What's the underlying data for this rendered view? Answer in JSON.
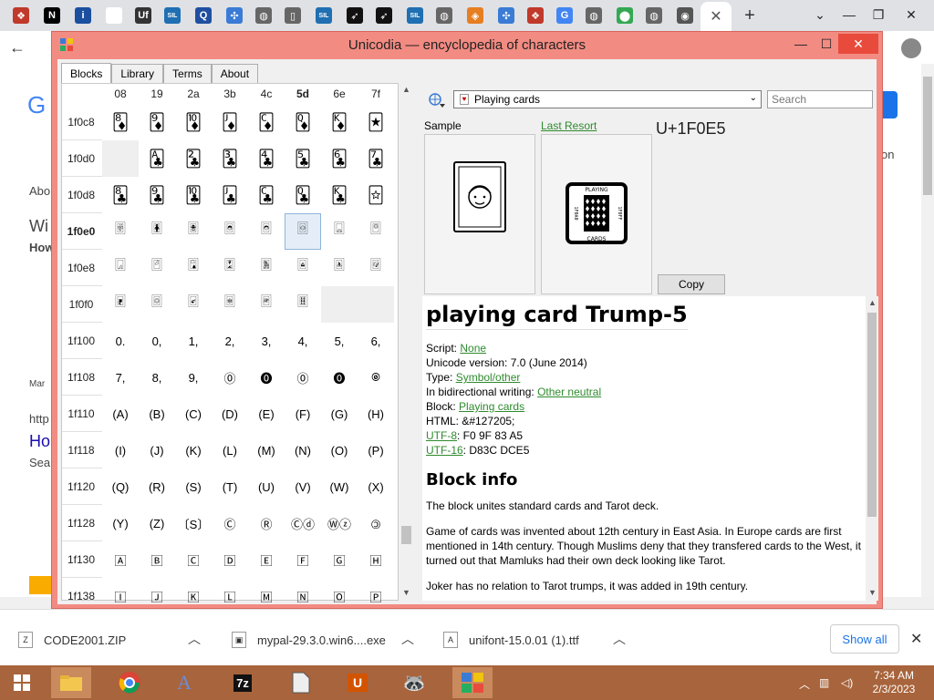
{
  "browser": {
    "tabs": [
      {
        "icon": "unicodia-icon",
        "glyph": "❖",
        "color": "#c0392b"
      },
      {
        "icon": "notion-icon",
        "glyph": "N",
        "color": "#000000"
      },
      {
        "icon": "info-icon",
        "glyph": "i",
        "color": "#1a4fa0"
      },
      {
        "icon": "blank-icon",
        "glyph": "",
        "color": "#ffffff"
      },
      {
        "icon": "uf-icon",
        "glyph": "Uf",
        "color": "#333333"
      },
      {
        "icon": "sil-icon",
        "glyph": "SIL",
        "color": "#1f6fb2"
      },
      {
        "icon": "q-icon",
        "glyph": "Q",
        "color": "#1f4fa0"
      },
      {
        "icon": "puzzle-icon",
        "glyph": "✣",
        "color": "#3a7bd5"
      },
      {
        "icon": "globe-icon",
        "glyph": "◍",
        "color": "#666666"
      },
      {
        "icon": "doc-icon",
        "glyph": "▯",
        "color": "#666666"
      },
      {
        "icon": "sil-icon",
        "glyph": "SIL",
        "color": "#1f6fb2"
      },
      {
        "icon": "feather-icon",
        "glyph": "➶",
        "color": "#111111"
      },
      {
        "icon": "feather-icon",
        "glyph": "➶",
        "color": "#111111"
      },
      {
        "icon": "sil-icon",
        "glyph": "SIL",
        "color": "#1f6fb2"
      },
      {
        "icon": "globe-icon",
        "glyph": "◍",
        "color": "#666666"
      },
      {
        "icon": "diamond-icon",
        "glyph": "◈",
        "color": "#e67e22"
      },
      {
        "icon": "puzzle-icon",
        "glyph": "✣",
        "color": "#3a7bd5"
      },
      {
        "icon": "unicodia-icon",
        "glyph": "❖",
        "color": "#c0392b"
      },
      {
        "icon": "google-icon",
        "glyph": "G",
        "color": "#4285f4"
      },
      {
        "icon": "globe-icon",
        "glyph": "◍",
        "color": "#666666"
      },
      {
        "icon": "maps-icon",
        "glyph": "⬤",
        "color": "#34a853"
      },
      {
        "icon": "globe-icon",
        "glyph": "◍",
        "color": "#666666"
      },
      {
        "icon": "shield-icon",
        "glyph": "◉",
        "color": "#555555"
      }
    ],
    "active_tab_close": "✕",
    "new_tab": "+",
    "background_texts": {
      "g_letter": "G",
      "abo": "Abo",
      "wi": "Wi",
      "how": "How",
      "mar": "Mar",
      "http": "http",
      "ho": "Ho",
      "sea": "Sea",
      "on": "on"
    }
  },
  "window": {
    "title": "Unicodia — encyclopedia of characters",
    "minimize": "—",
    "maximize": "☐",
    "close": "✕"
  },
  "tabs": [
    "Blocks",
    "Library",
    "Terms",
    "About"
  ],
  "grid": {
    "columns": [
      "08",
      "19",
      "2a",
      "3b",
      "4c",
      "5d",
      "6e",
      "7f"
    ],
    "bold_column": 5,
    "rows": [
      {
        "label": "1f0c8",
        "bold": false,
        "cells": [
          "🃈",
          "🃉",
          "🃊",
          "🃋",
          "🃌",
          "🃍",
          "🃎",
          "🃏"
        ],
        "card": true
      },
      {
        "label": "1f0d0",
        "bold": false,
        "cells": [
          "",
          "🃑",
          "🃒",
          "🃓",
          "🃔",
          "🃕",
          "🃖",
          "🃗"
        ],
        "card": true
      },
      {
        "label": "1f0d8",
        "bold": false,
        "cells": [
          "🃘",
          "🃙",
          "🃚",
          "🃛",
          "🃜",
          "🃝",
          "🃞",
          "🃟"
        ],
        "card": true
      },
      {
        "label": "1f0e0",
        "bold": true,
        "cells": [
          "🃠",
          "🃡",
          "🃢",
          "🃣",
          "🃤",
          "🃥",
          "🃦",
          "🃧"
        ],
        "card": true
      },
      {
        "label": "1f0e8",
        "bold": false,
        "cells": [
          "🃨",
          "🃩",
          "🃪",
          "🃫",
          "🃬",
          "🃭",
          "🃮",
          "🃯"
        ],
        "card": true
      },
      {
        "label": "1f0f0",
        "bold": false,
        "cells": [
          "🃰",
          "🃱",
          "🃲",
          "🃳",
          "🃴",
          "🃵",
          "",
          ""
        ],
        "card": true
      },
      {
        "label": "1f100",
        "bold": false,
        "cells": [
          "0.",
          "0,",
          "1,",
          "2,",
          "3,",
          "4,",
          "5,",
          "6,"
        ],
        "card": false
      },
      {
        "label": "1f108",
        "bold": false,
        "cells": [
          "7,",
          "8,",
          "9,",
          "⓪",
          "⓿",
          "🄋",
          "🄌",
          "🄍"
        ],
        "card": false
      },
      {
        "label": "1f110",
        "bold": false,
        "cells": [
          "(A)",
          "(B)",
          "(C)",
          "(D)",
          "(E)",
          "(F)",
          "(G)",
          "(H)"
        ],
        "card": false
      },
      {
        "label": "1f118",
        "bold": false,
        "cells": [
          "(I)",
          "(J)",
          "(K)",
          "(L)",
          "(M)",
          "(N)",
          "(O)",
          "(P)"
        ],
        "card": false
      },
      {
        "label": "1f120",
        "bold": false,
        "cells": [
          "(Q)",
          "(R)",
          "(S)",
          "(T)",
          "(U)",
          "(V)",
          "(W)",
          "(X)"
        ],
        "card": false
      },
      {
        "label": "1f128",
        "bold": false,
        "cells": [
          "(Y)",
          "(Z)",
          "〔S〕",
          "Ⓒ",
          "Ⓡ",
          "Ⓒⓓ",
          "Ⓦⓩ",
          "🄯"
        ],
        "card": false
      },
      {
        "label": "1f130",
        "bold": false,
        "cells": [
          "🄰",
          "🄱",
          "🄲",
          "🄳",
          "🄴",
          "🄵",
          "🄶",
          "🄷"
        ],
        "card": false
      },
      {
        "label": "1f138",
        "bold": false,
        "cells": [
          "🄸",
          "🄹",
          "🄺",
          "🄻",
          "🄼",
          "🄽",
          "🄾",
          "🄿"
        ],
        "card": false
      }
    ]
  },
  "right": {
    "block_combo": "Playing cards",
    "search_placeholder": "Search",
    "sample_label": "Sample",
    "last_resort_label": "Last Resort",
    "codepoint": "U+1F0E5",
    "copy_button": "Copy",
    "lr_top": "PLAYING",
    "lr_bottom": "CARDS",
    "lr_left": "1F0A0",
    "lr_right": "1F0FF"
  },
  "info": {
    "char_name": "playing card Trump-5",
    "script_label": "Script:",
    "script_value": "None",
    "version": "Unicode version: 7.0 (June 2014)",
    "type_label": "Type:",
    "type_value": "Symbol/other",
    "bidi_label": "In bidirectional writing:",
    "bidi_value": "Other neutral",
    "block_label": "Block:",
    "block_value": "Playing cards",
    "html": "HTML: &#127205;",
    "utf8_label": "UTF-8",
    "utf8_value": ": F0 9F 83 A5",
    "utf16_label": "UTF-16",
    "utf16_value": ": D83C DCE5",
    "block_info_heading": "Block info",
    "para1": "The block unites standard cards and Tarot deck.",
    "para2": "Game of cards was invented about 12th century in East Asia. In Europe cards are first mentioned in 14th century. Though Muslims deny that they transfered cards to the West, it turned out that Mamluks had their own deck looking like Tarot.",
    "para3": "Joker has no relation to Tarot trumps, it was added in 19th century."
  },
  "downloads": {
    "items": [
      {
        "name": "CODE2001.ZIP",
        "icon": "zip-icon"
      },
      {
        "name": "mypal-29.3.0.win6....exe",
        "icon": "exe-icon"
      },
      {
        "name": "unifont-15.0.01 (1).ttf",
        "icon": "font-file-icon"
      }
    ],
    "show_all": "Show all",
    "close": "✕"
  },
  "taskbar": {
    "time": "7:34 AM",
    "date": "2/3/2023",
    "colors": {
      "taskbar": "#a8643c",
      "accent": "#f28b82"
    }
  }
}
